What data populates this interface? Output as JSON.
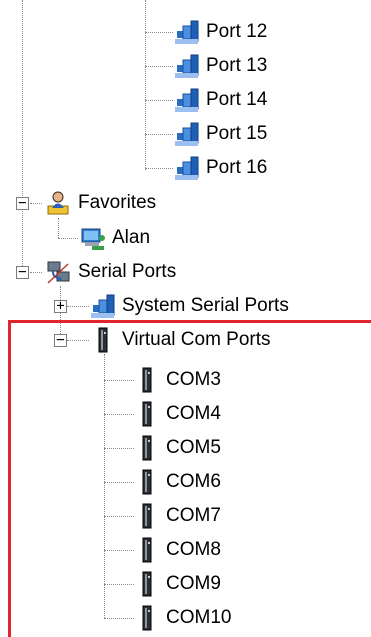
{
  "colors": {
    "highlight": "#e0262b",
    "tree_line": "#8a8a8a"
  },
  "tree": {
    "ports": [
      {
        "label": "Port 12",
        "icon": "serial-port-icon"
      },
      {
        "label": "Port 13",
        "icon": "serial-port-icon"
      },
      {
        "label": "Port 14",
        "icon": "serial-port-icon"
      },
      {
        "label": "Port 15",
        "icon": "serial-port-icon"
      },
      {
        "label": "Port 16",
        "icon": "serial-port-icon"
      }
    ],
    "favorites": {
      "label": "Favorites",
      "icon": "user-folder-icon",
      "expander": "−",
      "children": [
        {
          "label": "Alan",
          "icon": "network-computer-icon"
        }
      ]
    },
    "serial_ports": {
      "label": "Serial Ports",
      "icon": "serial-cable-icon",
      "expander": "−",
      "system": {
        "label": "System Serial Ports",
        "icon": "serial-port-icon",
        "expander": "+"
      },
      "virtual": {
        "label": "Virtual Com Ports",
        "icon": "virtual-port-icon",
        "expander": "−",
        "children": [
          {
            "label": "COM3"
          },
          {
            "label": "COM4"
          },
          {
            "label": "COM5"
          },
          {
            "label": "COM6"
          },
          {
            "label": "COM7"
          },
          {
            "label": "COM8"
          },
          {
            "label": "COM9"
          },
          {
            "label": "COM10"
          }
        ]
      }
    }
  }
}
